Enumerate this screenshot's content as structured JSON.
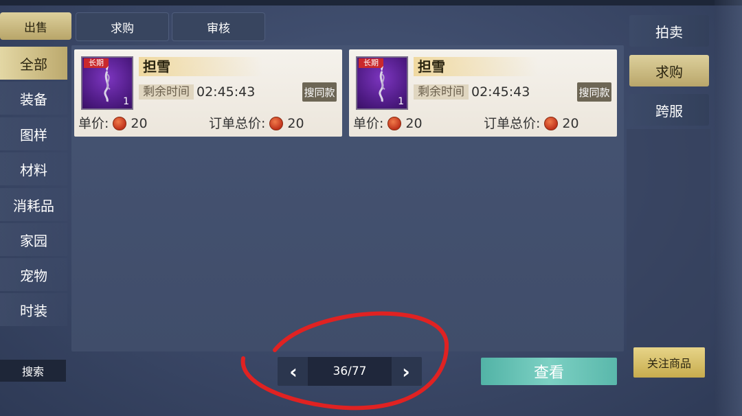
{
  "top_tabs": [
    {
      "label": "出售",
      "active": true
    },
    {
      "label": "求购",
      "active": false
    },
    {
      "label": "审核",
      "active": false
    }
  ],
  "categories": [
    {
      "label": "全部",
      "active": true
    },
    {
      "label": "装备",
      "active": false
    },
    {
      "label": "图样",
      "active": false
    },
    {
      "label": "材料",
      "active": false
    },
    {
      "label": "消耗品",
      "active": false
    },
    {
      "label": "家园",
      "active": false
    },
    {
      "label": "宠物",
      "active": false
    },
    {
      "label": "时装",
      "active": false
    }
  ],
  "listings": [
    {
      "tag": "长期",
      "quantity": "1",
      "name": "担雪",
      "remaining_label": "剩余时间",
      "remaining_time": "02:45:43",
      "search_same_label": "搜同款",
      "unit_price_label": "单价:",
      "unit_price": "20",
      "order_total_label": "订单总价:",
      "order_total": "20"
    },
    {
      "tag": "长期",
      "quantity": "1",
      "name": "担雪",
      "remaining_label": "剩余时间",
      "remaining_time": "02:45:43",
      "search_same_label": "搜同款",
      "unit_price_label": "单价:",
      "unit_price": "20",
      "order_total_label": "订单总价:",
      "order_total": "20"
    }
  ],
  "right_tabs": [
    {
      "label": "拍卖",
      "active": false
    },
    {
      "label": "求购",
      "active": true
    },
    {
      "label": "跨服",
      "active": false
    }
  ],
  "bottom": {
    "search_label": "搜索",
    "page": "36/77",
    "view_label": "查看",
    "follow_label": "关注商品"
  },
  "colors": {
    "gold_accent": "#c9b676",
    "annotation_red": "#e02222",
    "view_button": "#66c2b5"
  }
}
